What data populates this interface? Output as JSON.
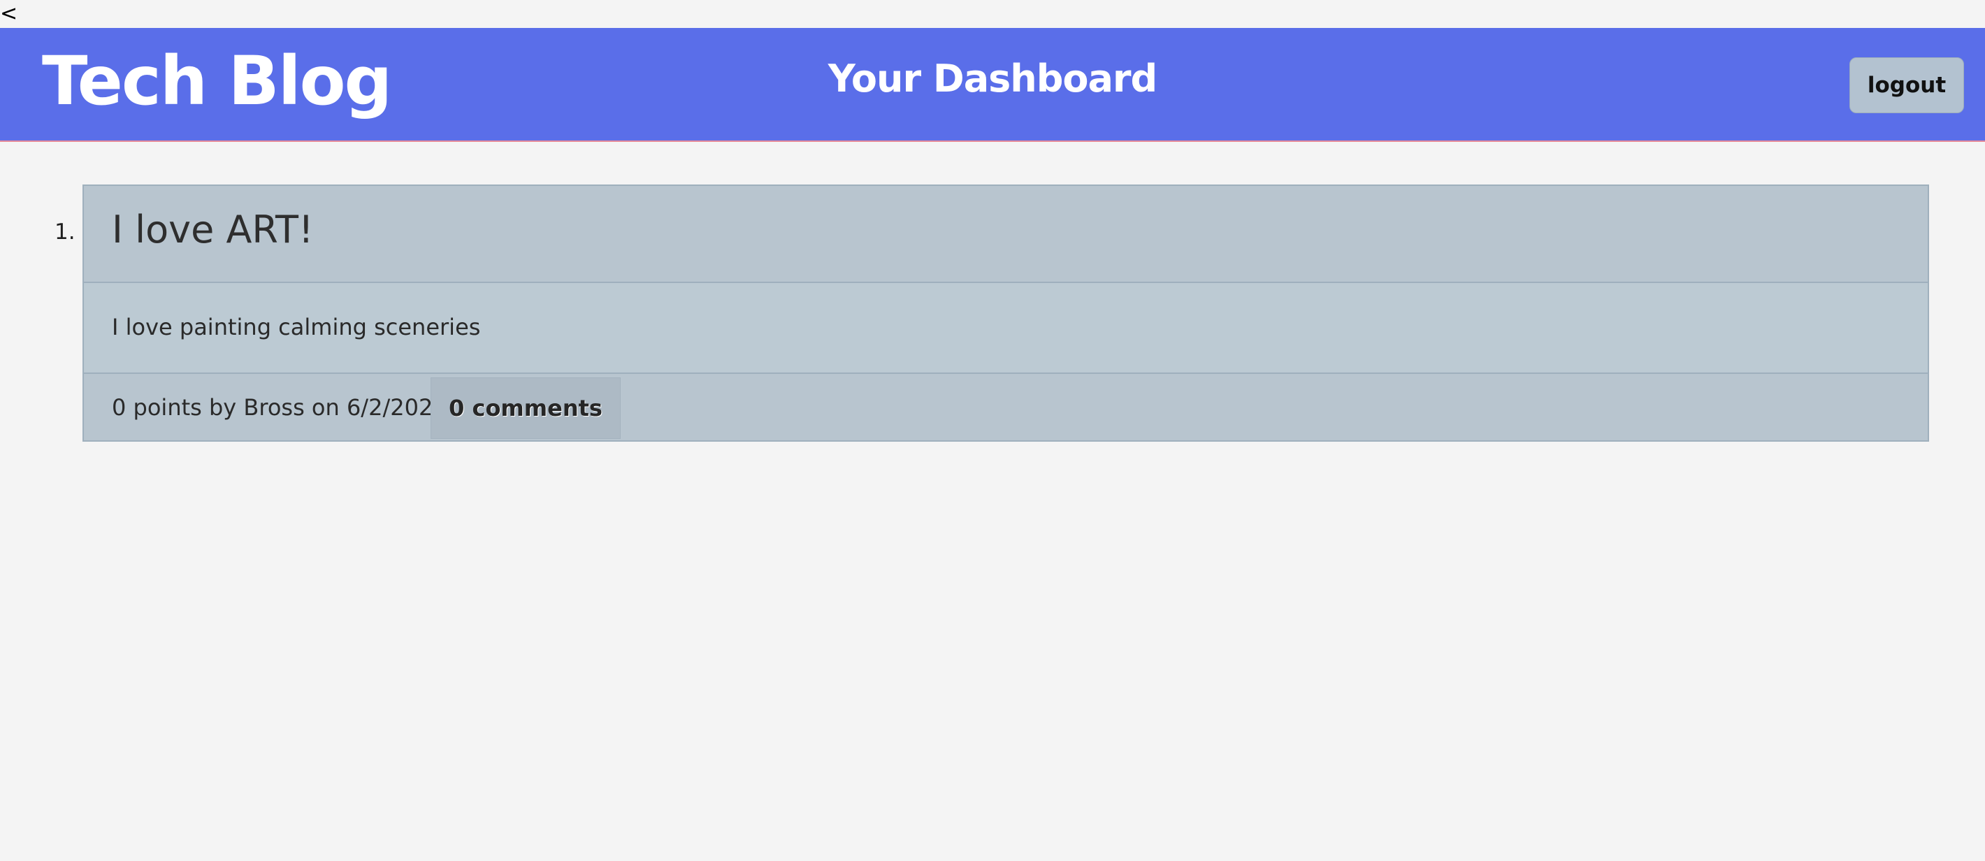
{
  "page": {
    "stray_char": "<"
  },
  "header": {
    "brand": "Tech Blog",
    "title": "Your Dashboard",
    "logout_label": "logout",
    "background_color": "#5a6ee9"
  },
  "posts": [
    {
      "number": "1.",
      "title": "I love ART!",
      "content": "I love painting calming sceneries",
      "meta": "0 points by Bross on 6/2/2021 |",
      "comments_label": "0 comments"
    }
  ]
}
